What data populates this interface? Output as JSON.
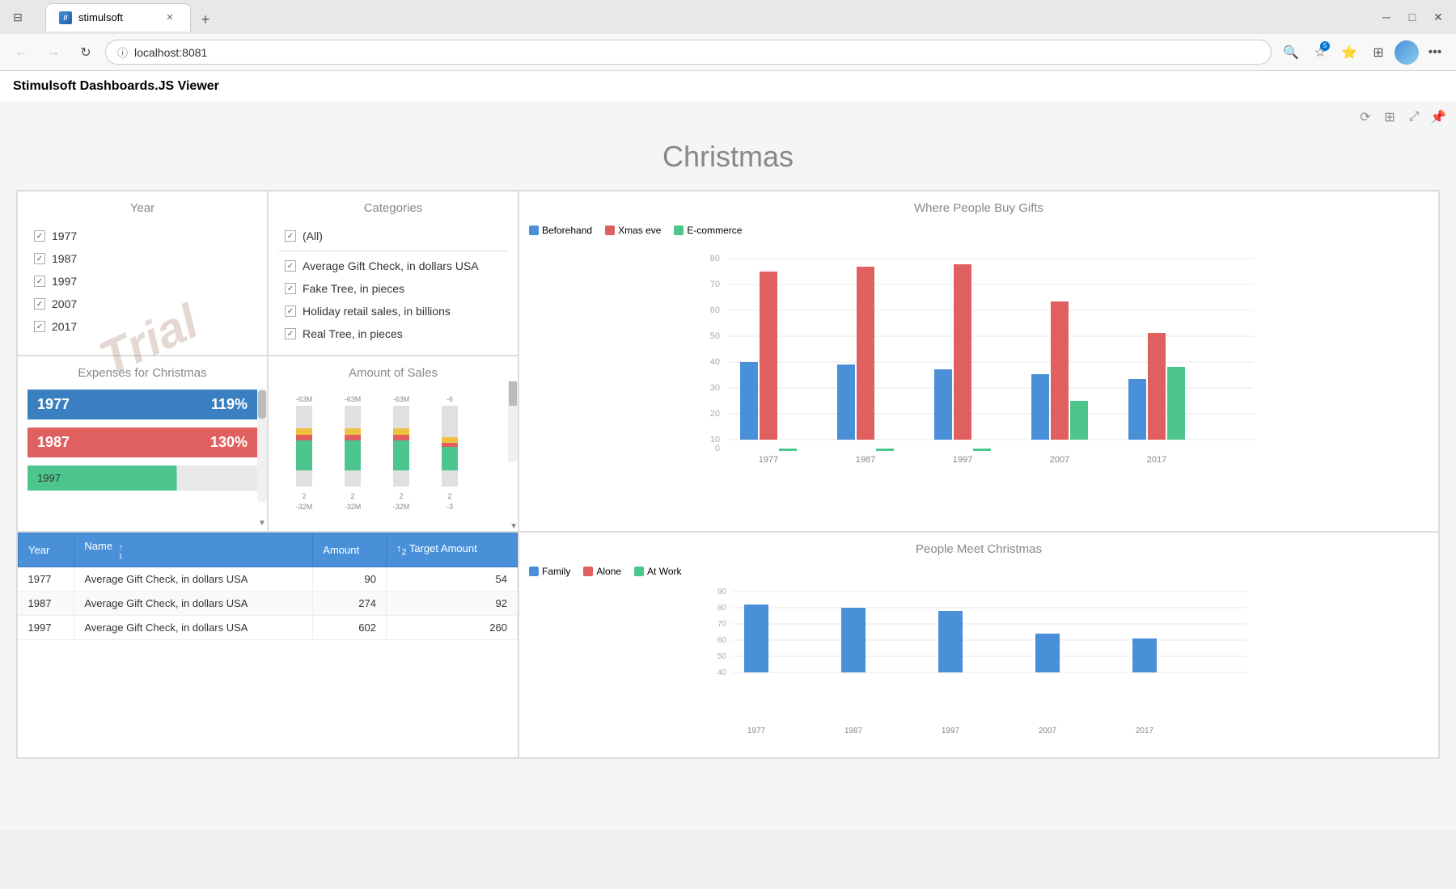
{
  "browser": {
    "tab_title": "stimulsoft",
    "tab_favicon": "//",
    "url": "localhost:8081",
    "new_tab_label": "+",
    "nav": {
      "back": "←",
      "forward": "→",
      "refresh": "↻"
    }
  },
  "page": {
    "header": "Stimulsoft Dashboards.JS Viewer"
  },
  "dashboard": {
    "title": "Christmas",
    "trial_watermark": "Trial",
    "year_panel": {
      "title": "Year",
      "years": [
        "1977",
        "1987",
        "1997",
        "2007",
        "2017"
      ]
    },
    "categories_panel": {
      "title": "Categories",
      "items": [
        "(All)",
        "Average Gift Check, in dollars USA",
        "Fake Tree, in pieces",
        "Holiday retail sales, in billions",
        "Real Tree, in pieces"
      ]
    },
    "gifts_panel": {
      "title": "Where People Buy Gifts",
      "legend": [
        {
          "label": "Beforehand",
          "color": "#4a90d9"
        },
        {
          "label": "Xmas eve",
          "color": "#e06060"
        },
        {
          "label": "E-commerce",
          "color": "#4dc68e"
        }
      ],
      "y_labels": [
        "80",
        "70",
        "60",
        "50",
        "40",
        "30",
        "20",
        "10",
        "0"
      ],
      "x_labels": [
        "1977",
        "1987",
        "1997",
        "2007",
        "2017"
      ],
      "data": {
        "beforehand": [
          32,
          31,
          29,
          27,
          25
        ],
        "xmas_eve": [
          68,
          70,
          71,
          57,
          44
        ],
        "ecommerce": [
          1,
          1,
          1,
          16,
          30
        ]
      }
    },
    "expenses_panel": {
      "title": "Expenses for Christmas",
      "bars": [
        {
          "year": "1977",
          "value": "119%",
          "color": "blue"
        },
        {
          "year": "1987",
          "value": "130%",
          "color": "pink"
        },
        {
          "year": "1997",
          "color": "green",
          "pct": 75
        }
      ]
    },
    "sales_panel": {
      "title": "Amount of Sales",
      "labels": [
        "-63M",
        "-32M"
      ],
      "y_markers": [
        "-63M",
        "2",
        "-32M",
        "2",
        "-63M",
        "2",
        "-32M",
        "2",
        "-6",
        "2",
        "-3"
      ]
    },
    "table": {
      "columns": [
        "Year",
        "Name",
        "Amount",
        "Target Amount"
      ],
      "rows": [
        {
          "year": "1977",
          "name": "Average Gift Check, in dollars USA",
          "amount": "90",
          "target": "54"
        },
        {
          "year": "1987",
          "name": "Average Gift Check, in dollars USA",
          "amount": "274",
          "target": "92"
        },
        {
          "year": "1997",
          "name": "Average Gift Check, in dollars USA",
          "amount": "602",
          "target": "260"
        }
      ]
    },
    "meet_panel": {
      "title": "People Meet Christmas",
      "legend": [
        {
          "label": "Family",
          "color": "#4a90d9"
        },
        {
          "label": "Alone",
          "color": "#e06060"
        },
        {
          "label": "At Work",
          "color": "#4dc68e"
        }
      ],
      "y_labels": [
        "90",
        "80",
        "70",
        "60",
        "50",
        "40"
      ],
      "data": {
        "family": [
          82,
          80,
          78,
          64,
          61
        ]
      }
    }
  }
}
